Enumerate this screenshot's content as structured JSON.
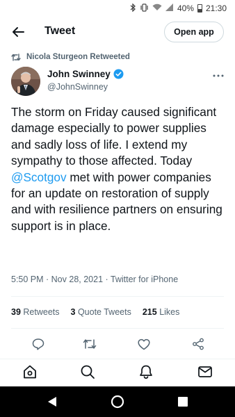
{
  "status_bar": {
    "battery": "40%",
    "time": "21:30",
    "icons": [
      "bluetooth-icon",
      "vibrate-icon",
      "wifi-icon",
      "signal-icon",
      "battery-icon"
    ]
  },
  "header": {
    "title": "Tweet",
    "open_app_label": "Open app",
    "back_icon": "arrow-left-icon"
  },
  "retweet": {
    "label": "Nicola Sturgeon Retweeted",
    "icon": "retweet-icon"
  },
  "author": {
    "name": "John Swinney",
    "handle": "@JohnSwinney",
    "verified": true
  },
  "tweet": {
    "text_before": "The storm on Friday caused significant damage especially to power supplies and sadly loss of life. I extend my sympathy to those affected. Today ",
    "mention": "@Scotgov",
    "text_after": " met with power companies for an update on restoration of supply and with resilience partners on ensuring support is in place.",
    "timestamp": "5:50 PM · Nov 28, 2021 · Twitter for iPhone"
  },
  "stats": {
    "retweets_count": "39",
    "retweets_label": "Retweets",
    "quotes_count": "3",
    "quotes_label": "Quote Tweets",
    "likes_count": "215",
    "likes_label": "Likes"
  },
  "actions": [
    "reply-icon",
    "retweet-icon",
    "like-icon",
    "share-icon"
  ],
  "bottom_nav": [
    "home-icon",
    "search-icon",
    "notifications-icon",
    "messages-icon"
  ],
  "colors": {
    "accent": "#1d9bf0",
    "text_primary": "#0f1419",
    "text_secondary": "#536471",
    "divider": "#eff3f4"
  }
}
